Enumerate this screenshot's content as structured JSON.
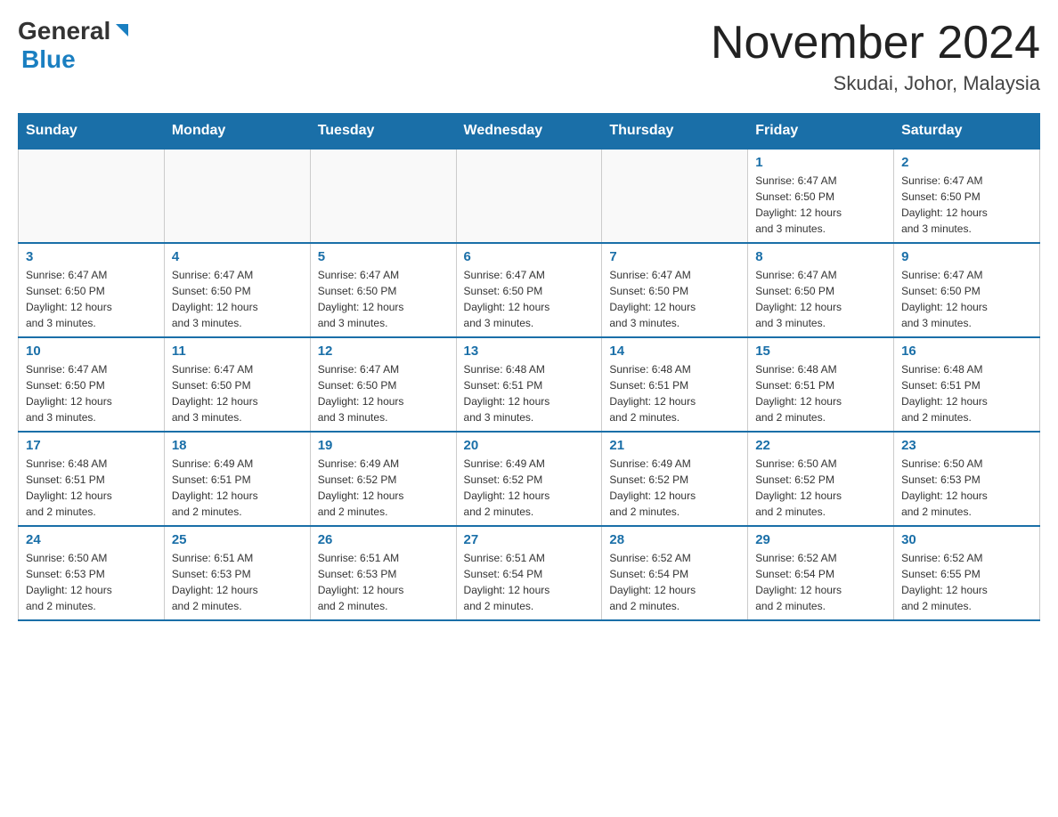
{
  "header": {
    "logo_general": "General",
    "logo_blue": "Blue",
    "month_title": "November 2024",
    "subtitle": "Skudai, Johor, Malaysia"
  },
  "weekdays": [
    "Sunday",
    "Monday",
    "Tuesday",
    "Wednesday",
    "Thursday",
    "Friday",
    "Saturday"
  ],
  "weeks": [
    {
      "days": [
        {
          "num": "",
          "info": ""
        },
        {
          "num": "",
          "info": ""
        },
        {
          "num": "",
          "info": ""
        },
        {
          "num": "",
          "info": ""
        },
        {
          "num": "",
          "info": ""
        },
        {
          "num": "1",
          "info": "Sunrise: 6:47 AM\nSunset: 6:50 PM\nDaylight: 12 hours\nand 3 minutes."
        },
        {
          "num": "2",
          "info": "Sunrise: 6:47 AM\nSunset: 6:50 PM\nDaylight: 12 hours\nand 3 minutes."
        }
      ]
    },
    {
      "days": [
        {
          "num": "3",
          "info": "Sunrise: 6:47 AM\nSunset: 6:50 PM\nDaylight: 12 hours\nand 3 minutes."
        },
        {
          "num": "4",
          "info": "Sunrise: 6:47 AM\nSunset: 6:50 PM\nDaylight: 12 hours\nand 3 minutes."
        },
        {
          "num": "5",
          "info": "Sunrise: 6:47 AM\nSunset: 6:50 PM\nDaylight: 12 hours\nand 3 minutes."
        },
        {
          "num": "6",
          "info": "Sunrise: 6:47 AM\nSunset: 6:50 PM\nDaylight: 12 hours\nand 3 minutes."
        },
        {
          "num": "7",
          "info": "Sunrise: 6:47 AM\nSunset: 6:50 PM\nDaylight: 12 hours\nand 3 minutes."
        },
        {
          "num": "8",
          "info": "Sunrise: 6:47 AM\nSunset: 6:50 PM\nDaylight: 12 hours\nand 3 minutes."
        },
        {
          "num": "9",
          "info": "Sunrise: 6:47 AM\nSunset: 6:50 PM\nDaylight: 12 hours\nand 3 minutes."
        }
      ]
    },
    {
      "days": [
        {
          "num": "10",
          "info": "Sunrise: 6:47 AM\nSunset: 6:50 PM\nDaylight: 12 hours\nand 3 minutes."
        },
        {
          "num": "11",
          "info": "Sunrise: 6:47 AM\nSunset: 6:50 PM\nDaylight: 12 hours\nand 3 minutes."
        },
        {
          "num": "12",
          "info": "Sunrise: 6:47 AM\nSunset: 6:50 PM\nDaylight: 12 hours\nand 3 minutes."
        },
        {
          "num": "13",
          "info": "Sunrise: 6:48 AM\nSunset: 6:51 PM\nDaylight: 12 hours\nand 3 minutes."
        },
        {
          "num": "14",
          "info": "Sunrise: 6:48 AM\nSunset: 6:51 PM\nDaylight: 12 hours\nand 2 minutes."
        },
        {
          "num": "15",
          "info": "Sunrise: 6:48 AM\nSunset: 6:51 PM\nDaylight: 12 hours\nand 2 minutes."
        },
        {
          "num": "16",
          "info": "Sunrise: 6:48 AM\nSunset: 6:51 PM\nDaylight: 12 hours\nand 2 minutes."
        }
      ]
    },
    {
      "days": [
        {
          "num": "17",
          "info": "Sunrise: 6:48 AM\nSunset: 6:51 PM\nDaylight: 12 hours\nand 2 minutes."
        },
        {
          "num": "18",
          "info": "Sunrise: 6:49 AM\nSunset: 6:51 PM\nDaylight: 12 hours\nand 2 minutes."
        },
        {
          "num": "19",
          "info": "Sunrise: 6:49 AM\nSunset: 6:52 PM\nDaylight: 12 hours\nand 2 minutes."
        },
        {
          "num": "20",
          "info": "Sunrise: 6:49 AM\nSunset: 6:52 PM\nDaylight: 12 hours\nand 2 minutes."
        },
        {
          "num": "21",
          "info": "Sunrise: 6:49 AM\nSunset: 6:52 PM\nDaylight: 12 hours\nand 2 minutes."
        },
        {
          "num": "22",
          "info": "Sunrise: 6:50 AM\nSunset: 6:52 PM\nDaylight: 12 hours\nand 2 minutes."
        },
        {
          "num": "23",
          "info": "Sunrise: 6:50 AM\nSunset: 6:53 PM\nDaylight: 12 hours\nand 2 minutes."
        }
      ]
    },
    {
      "days": [
        {
          "num": "24",
          "info": "Sunrise: 6:50 AM\nSunset: 6:53 PM\nDaylight: 12 hours\nand 2 minutes."
        },
        {
          "num": "25",
          "info": "Sunrise: 6:51 AM\nSunset: 6:53 PM\nDaylight: 12 hours\nand 2 minutes."
        },
        {
          "num": "26",
          "info": "Sunrise: 6:51 AM\nSunset: 6:53 PM\nDaylight: 12 hours\nand 2 minutes."
        },
        {
          "num": "27",
          "info": "Sunrise: 6:51 AM\nSunset: 6:54 PM\nDaylight: 12 hours\nand 2 minutes."
        },
        {
          "num": "28",
          "info": "Sunrise: 6:52 AM\nSunset: 6:54 PM\nDaylight: 12 hours\nand 2 minutes."
        },
        {
          "num": "29",
          "info": "Sunrise: 6:52 AM\nSunset: 6:54 PM\nDaylight: 12 hours\nand 2 minutes."
        },
        {
          "num": "30",
          "info": "Sunrise: 6:52 AM\nSunset: 6:55 PM\nDaylight: 12 hours\nand 2 minutes."
        }
      ]
    }
  ]
}
